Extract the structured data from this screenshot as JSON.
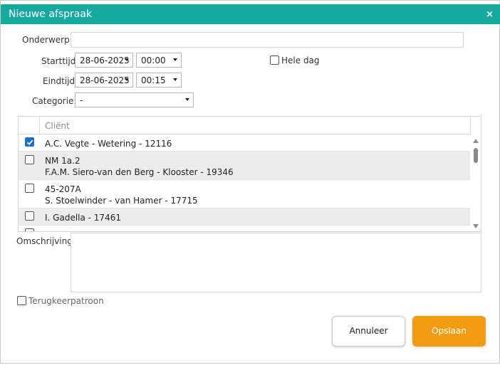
{
  "dialog": {
    "title": "Nieuwe afspraak",
    "close_glyph": "×"
  },
  "form": {
    "subject_label": "Onderwerp:",
    "subject_value": "",
    "start_label": "Starttijd",
    "start_date": "28-06-2025",
    "start_time": "00:00",
    "all_day_label": "Hele dag",
    "all_day_checked": false,
    "end_label": "Eindtijd",
    "end_date": "28-06-2025",
    "end_time": "00:15",
    "category_label": "Categorie:",
    "category_value": "-",
    "description_label": "Omschrijving:",
    "description_value": "",
    "recurrence_label": "Terugkeerpatroon",
    "recurrence_checked": false
  },
  "client_grid": {
    "column_header": "Cliënt",
    "rows": [
      {
        "line1": "A.C. Vegte - Wetering - 12116",
        "line2": "",
        "checked": true
      },
      {
        "line1": "NM 1a.2",
        "line2": "F.A.M. Siero-van den Berg - Klooster - 19346",
        "checked": false
      },
      {
        "line1": "45-207A",
        "line2": "S. Stoelwinder - van Hamer - 17715",
        "checked": false
      },
      {
        "line1": "I. Gadella - 17461",
        "line2": "",
        "checked": false
      }
    ]
  },
  "buttons": {
    "cancel": "Annuleer",
    "save": "Opslaan"
  },
  "colors": {
    "title_bar": "#16aa9e",
    "save_button": "#f39c12",
    "checkbox_checked": "#1a6fd6"
  }
}
